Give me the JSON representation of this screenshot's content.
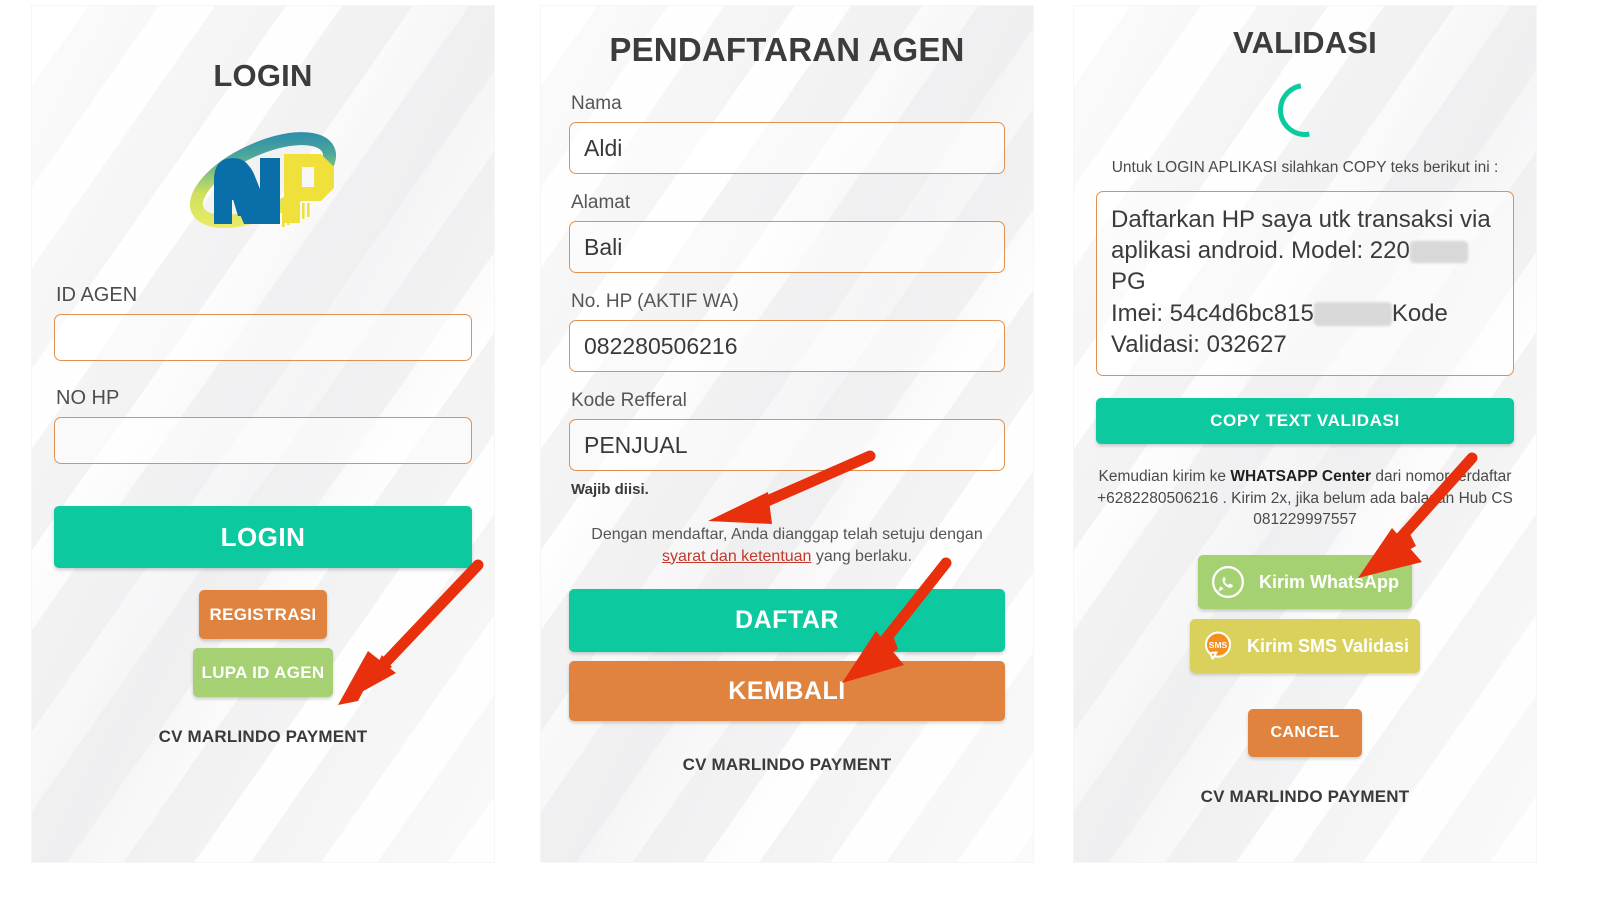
{
  "login": {
    "title": "LOGIN",
    "logo_alt": "mp-logo",
    "label_id": "ID AGEN",
    "value_id": "",
    "label_hp": "NO HP",
    "value_hp": "",
    "btn_login": "LOGIN",
    "btn_registrasi": "REGISTRASI",
    "btn_lupa": "LUPA ID AGEN",
    "footer": "CV MARLINDO PAYMENT"
  },
  "register": {
    "title": "PENDAFTARAN AGEN",
    "label_nama": "Nama",
    "value_nama": "Aldi",
    "label_alamat": "Alamat",
    "value_alamat": "Bali",
    "label_hp": "No. HP (AKTIF WA)",
    "value_hp": "082280506216",
    "label_referral": "Kode Refferal",
    "value_referral": "PENJUAL",
    "required_note": "Wajib diisi.",
    "terms_pre": "Dengan mendaftar, Anda dianggap telah setuju dengan ",
    "terms_link": "syarat dan ketentuan",
    "terms_post": " yang berlaku.",
    "btn_daftar": "DAFTAR",
    "btn_kembali": "KEMBALI",
    "footer": "CV MARLINDO PAYMENT"
  },
  "validasi": {
    "title": "VALIDASI",
    "spinner_name": "loading-spinner",
    "hint": "Untuk LOGIN APLIKASI silahkan COPY teks berikut ini :",
    "text_line1": "Daftarkan HP saya utk transaksi via",
    "text_line2_a": "aplikasi android. Model: 220",
    "text_line2_b": "PG",
    "text_line3_a": "Imei: 54c4d6bc815",
    "text_line3_b": "Kode",
    "text_line4": "Validasi: 032627",
    "btn_copy": "COPY TEXT VALIDASI",
    "note_a": "Kemudian kirim ke ",
    "note_b": "WHATSAPP Center",
    "note_c": " dari nomor terdaftar +6282280506216 . Kirim 2x, jika belum ada balasan Hub CS 081229997557",
    "btn_whatsapp": "Kirim WhatsApp",
    "btn_sms": "Kirim SMS Validasi",
    "sms_icon_label": "SMS",
    "btn_cancel": "CANCEL",
    "footer": "CV MARLINDO PAYMENT"
  },
  "colors": {
    "teal": "#0cc9a0",
    "orange": "#e0833e",
    "light_green": "#a5d172",
    "yellow": "#d9d15c",
    "field_border": "#e09152",
    "arrow_red": "#e8300c",
    "link_red": "#c0392b",
    "logo_blue": "#0a6fa8",
    "logo_yellow": "#f0e03c"
  },
  "annotations": {
    "arrow_1": "arrow-to-registrasi",
    "arrow_2": "arrow-to-kode-refferal",
    "arrow_3": "arrow-to-daftar",
    "arrow_4": "arrow-to-kirim-whatsapp"
  }
}
